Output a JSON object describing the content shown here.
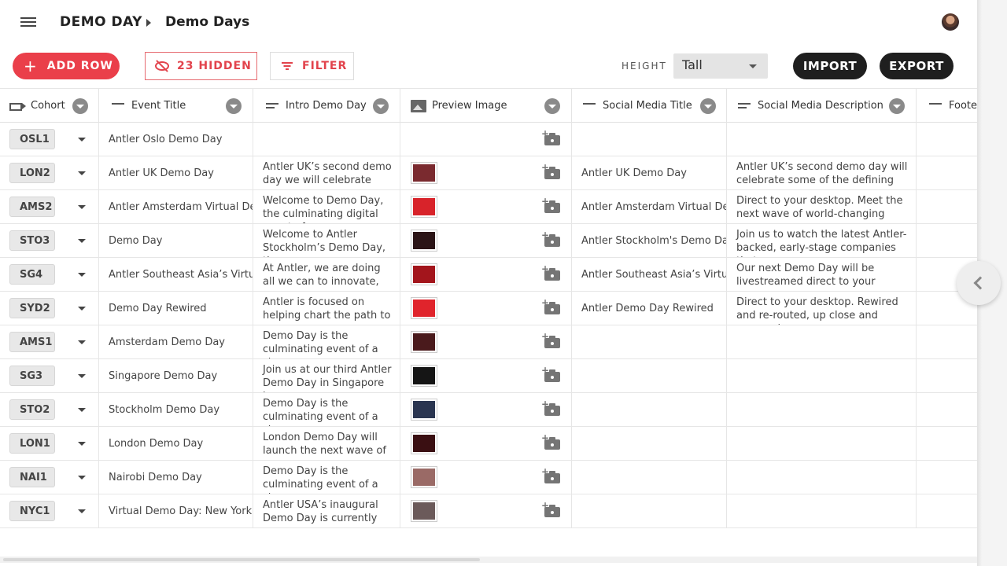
{
  "header": {
    "menu_icon": "hamburger-icon",
    "breadcrumb_root": "DEMO DAY",
    "breadcrumb_page": "Demo Days"
  },
  "toolbar": {
    "add_row": "ADD ROW",
    "hidden": "23 HIDDEN",
    "filter": "FILTER",
    "height_label": "HEIGHT",
    "height_value": "Tall",
    "import": "IMPORT",
    "export": "EXPORT"
  },
  "columns": [
    {
      "label": "Cohort",
      "icon": "link-field-icon"
    },
    {
      "label": "Event Title",
      "icon": "short-text-icon"
    },
    {
      "label": "Intro Demo Day",
      "icon": "long-text-icon"
    },
    {
      "label": "Preview Image",
      "icon": "image-icon"
    },
    {
      "label": "Social Media Title",
      "icon": "short-text-icon"
    },
    {
      "label": "Social Media Description",
      "icon": "long-text-icon"
    },
    {
      "label": "Footer",
      "icon": "short-text-icon"
    }
  ],
  "rows": [
    {
      "cohort": "OSL1",
      "title": "Antler Oslo Demo Day",
      "intro": "",
      "image": "",
      "social_title": "",
      "social_desc": ""
    },
    {
      "cohort": "LON2",
      "title": "Antler UK Demo Day",
      "intro": "Antler UK’s second demo day we will celebrate some",
      "image": "#7a2a2f",
      "social_title": "Antler UK Demo Day",
      "social_desc": "Antler UK’s second demo day will celebrate some of the defining"
    },
    {
      "cohort": "AMS2",
      "title": "Antler Amsterdam Virtual Demo Day",
      "intro": "Welcome to Demo Day, the culminating digital event of",
      "image": "#d8232a",
      "social_title": "Antler Amsterdam Virtual Demo Day",
      "social_desc": "Direct to your desktop. Meet the next wave of world-changing"
    },
    {
      "cohort": "STO3",
      "title": "Demo Day",
      "intro": "Welcome to Antler Stockholm’s Demo Day, the",
      "image": "#2b1416",
      "social_title": "Antler Stockholm's Demo Day - Antler",
      "social_desc": "Join us to watch the latest Antler-backed, early-stage companies that"
    },
    {
      "cohort": "SG4",
      "title": "Antler Southeast Asia’s Virtual Demo Day",
      "intro": "At Antler, we are doing all we can to innovate, move",
      "image": "#a3151c",
      "social_title": "Antler Southeast Asia’s Virtual Demo Day",
      "social_desc": "Our next Demo Day will be livestreamed direct to your screen."
    },
    {
      "cohort": "SYD2",
      "title": "Demo Day Rewired",
      "intro": "Antler is focused on helping chart the path to recovery",
      "image": "#e0242c",
      "social_title": "Antler Demo Day Rewired",
      "social_desc": "Direct to your desktop. Rewired and re-routed, up close and personal."
    },
    {
      "cohort": "AMS1",
      "title": "Amsterdam Demo Day",
      "intro": "Demo Day is the culminating event of a six-",
      "image": "#4a1a1c",
      "social_title": "",
      "social_desc": ""
    },
    {
      "cohort": "SG3",
      "title": "Singapore Demo Day",
      "intro": "Join us at our third Antler Demo Day in Singapore in",
      "image": "#151515",
      "social_title": "",
      "social_desc": ""
    },
    {
      "cohort": "STO2",
      "title": "Stockholm Demo Day",
      "intro": "Demo Day is the culminating event of a six-",
      "image": "#2a3550",
      "social_title": "",
      "social_desc": ""
    },
    {
      "cohort": "LON1",
      "title": "London Demo Day",
      "intro": "London Demo Day will launch the next wave of",
      "image": "#3a0f12",
      "social_title": "",
      "social_desc": ""
    },
    {
      "cohort": "NAI1",
      "title": "Nairobi Demo Day",
      "intro": "Demo Day is the culminating event of a six-",
      "image": "#9a6a66",
      "social_title": "",
      "social_desc": ""
    },
    {
      "cohort": "NYC1",
      "title": "Virtual Demo Day: New York",
      "intro": "Antler USA’s inaugural Demo Day is currently",
      "image": "#6b5a5a",
      "social_title": "",
      "social_desc": ""
    }
  ],
  "colors": {
    "accent": "#ea3f4a",
    "dark_button": "#1f1f1f"
  }
}
